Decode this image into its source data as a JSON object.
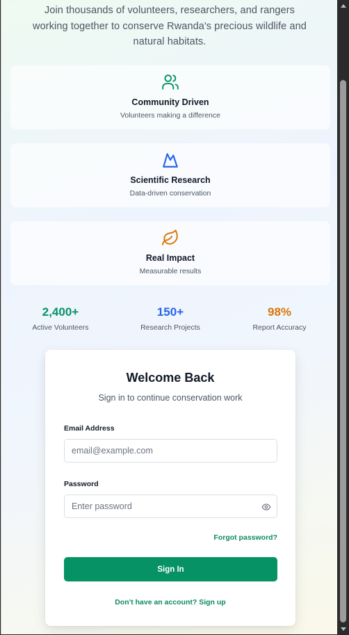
{
  "intro": {
    "text": "Join thousands of volunteers, researchers, and rangers working together to conserve Rwanda's precious wildlife and natural habitats."
  },
  "features": [
    {
      "title": "Community Driven",
      "subtitle": "Volunteers making a difference",
      "icon": "users-icon",
      "color": "#079266"
    },
    {
      "title": "Scientific Research",
      "subtitle": "Data-driven conservation",
      "icon": "mountain-icon",
      "color": "#2563eb"
    },
    {
      "title": "Real Impact",
      "subtitle": "Measurable results",
      "icon": "leaf-icon",
      "color": "#d97706"
    }
  ],
  "stats": [
    {
      "value": "2,400+",
      "label": "Active Volunteers",
      "color": "#079266"
    },
    {
      "value": "150+",
      "label": "Research Projects",
      "color": "#2563eb"
    },
    {
      "value": "98%",
      "label": "Report Accuracy",
      "color": "#d97706"
    }
  ],
  "login": {
    "title": "Welcome Back",
    "subtitle": "Sign in to continue conservation work",
    "email_label": "Email Address",
    "email_placeholder": "email@example.com",
    "password_label": "Password",
    "password_placeholder": "Enter password",
    "forgot_label": "Forgot password?",
    "submit_label": "Sign In",
    "signup_label": "Don't have an account? Sign up"
  },
  "colors": {
    "primary": "#079266",
    "blue": "#2563eb",
    "amber": "#d97706"
  }
}
